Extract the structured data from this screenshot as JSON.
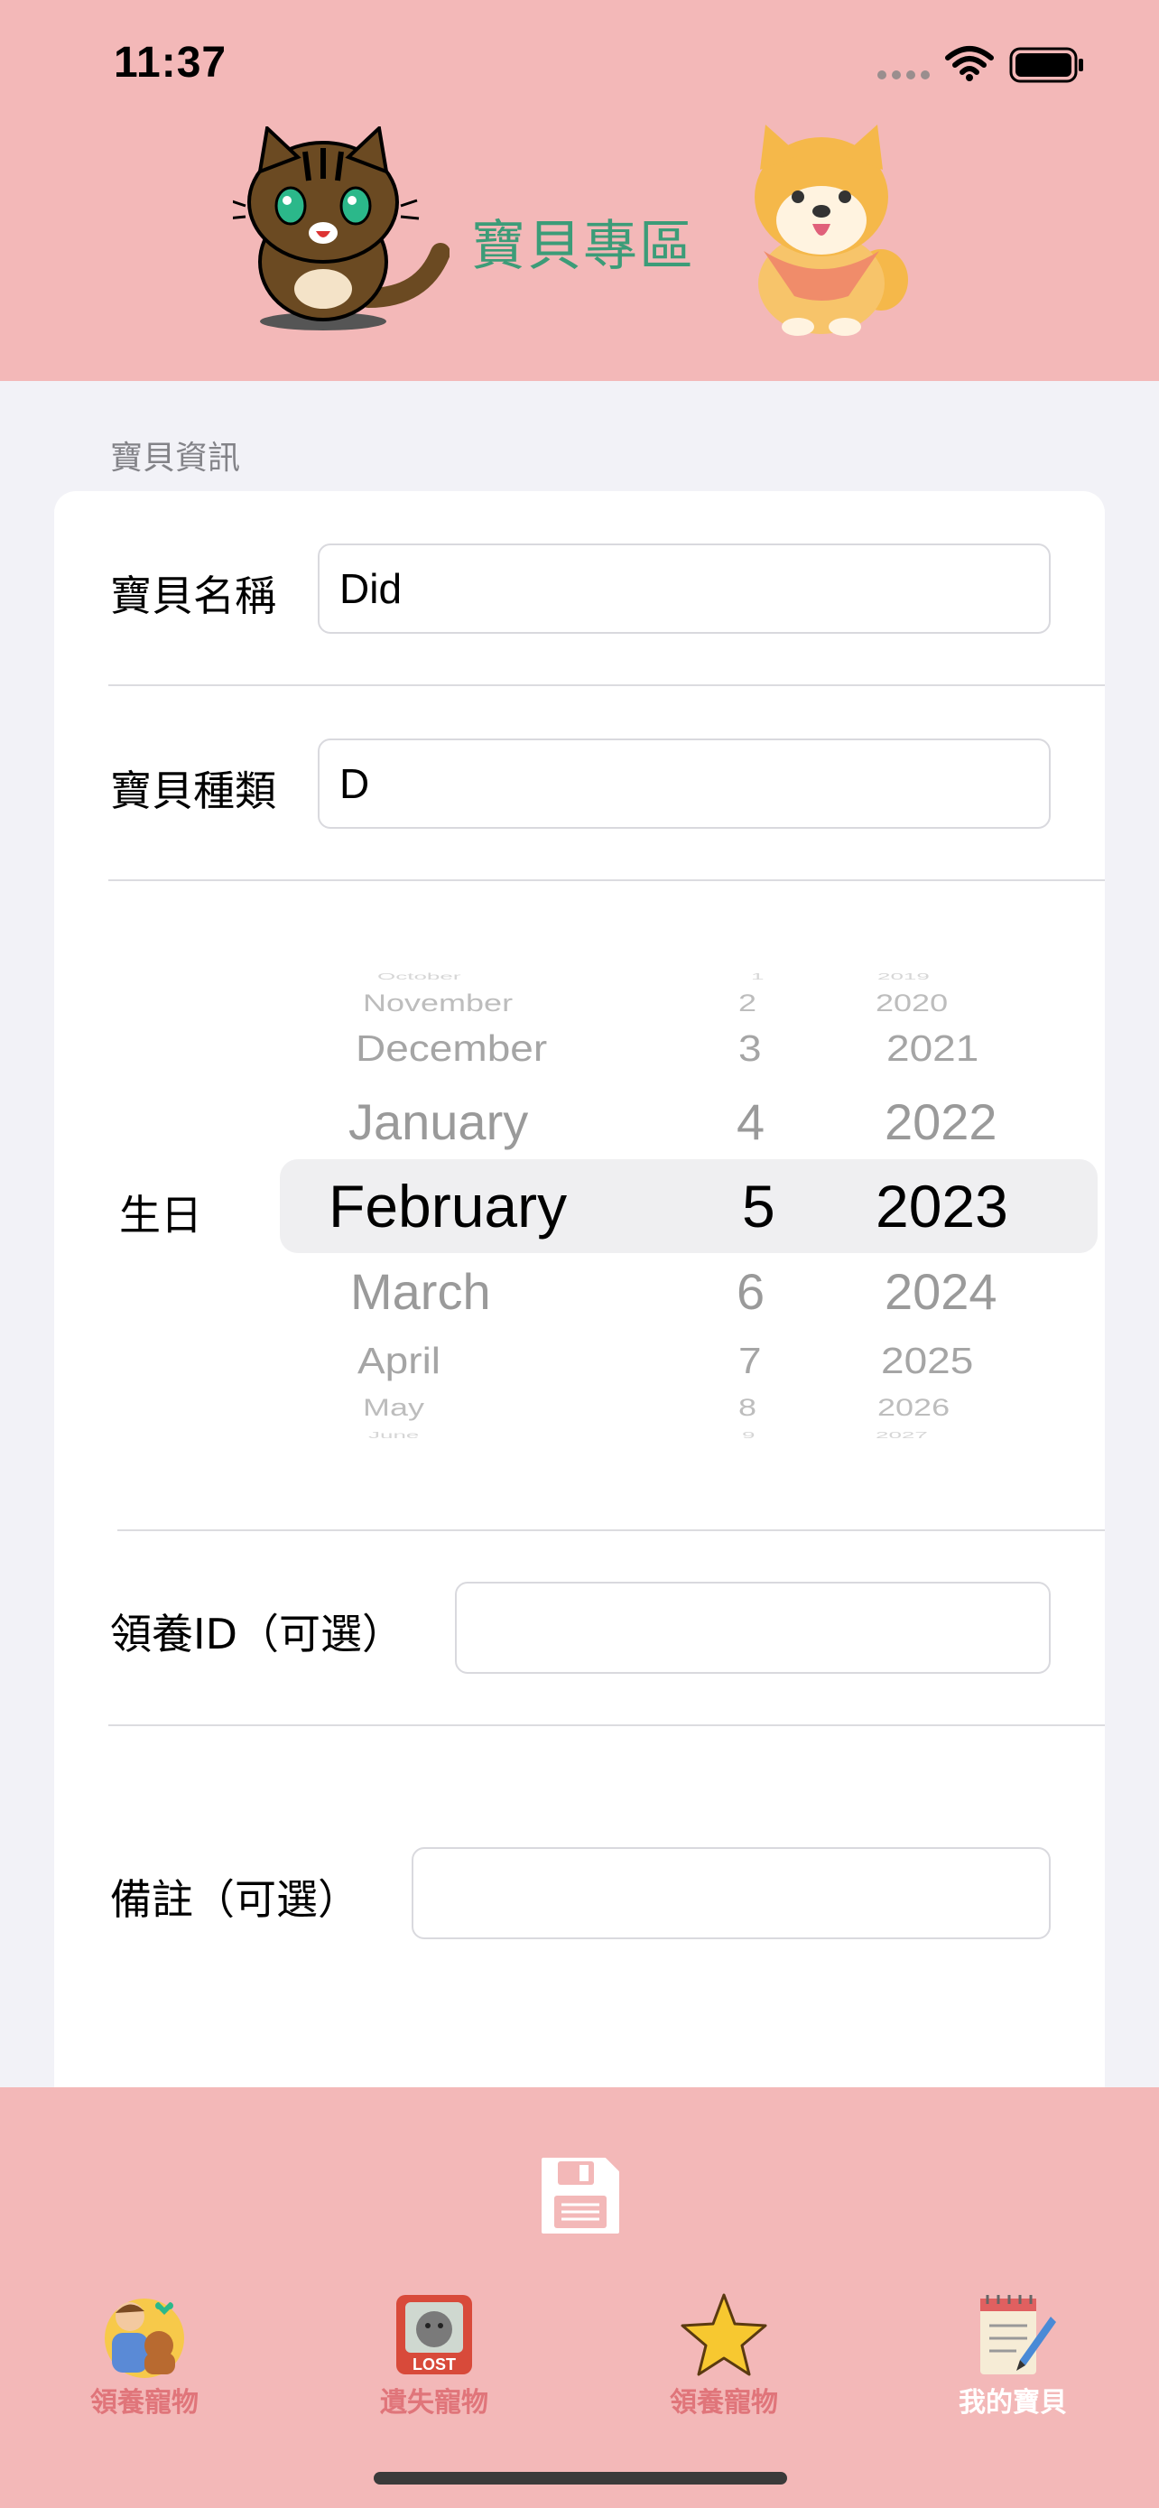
{
  "status_bar": {
    "time": "11:37"
  },
  "header": {
    "title": "寶貝專區"
  },
  "section": {
    "label": "寶貝資訊"
  },
  "form": {
    "name_label": "寶貝名稱",
    "name_value": "Did",
    "type_label": "寶貝種類",
    "type_value": "D",
    "birthday_label": "生日",
    "adopt_id_label": "領養ID（可選）",
    "adopt_id_value": "",
    "note_label": "備註（可選）",
    "note_value": ""
  },
  "date_picker": {
    "months": [
      "October",
      "November",
      "December",
      "January",
      "February",
      "March",
      "April",
      "May",
      "June"
    ],
    "days": [
      "1",
      "2",
      "3",
      "4",
      "5",
      "6",
      "7",
      "8",
      "9"
    ],
    "years": [
      "2019",
      "2020",
      "2021",
      "2022",
      "2023",
      "2024",
      "2025",
      "2026",
      "2027"
    ],
    "selected": {
      "month": "February",
      "day": "5",
      "year": "2023"
    }
  },
  "tab_bar": {
    "tabs": [
      {
        "label": "領養寵物",
        "icon": "adopt-pet-icon",
        "active": false
      },
      {
        "label": "遺失寵物",
        "icon": "lost-pet-icon",
        "active": false
      },
      {
        "label": "領養寵物",
        "icon": "star-icon",
        "active": false
      },
      {
        "label": "我的寶貝",
        "icon": "notepad-icon",
        "active": true
      }
    ]
  },
  "colors": {
    "header_bg": "#f3b8b8",
    "title_green": "#3c9c78",
    "tab_label": "#e0757a",
    "tab_label_active": "#ffffff"
  }
}
